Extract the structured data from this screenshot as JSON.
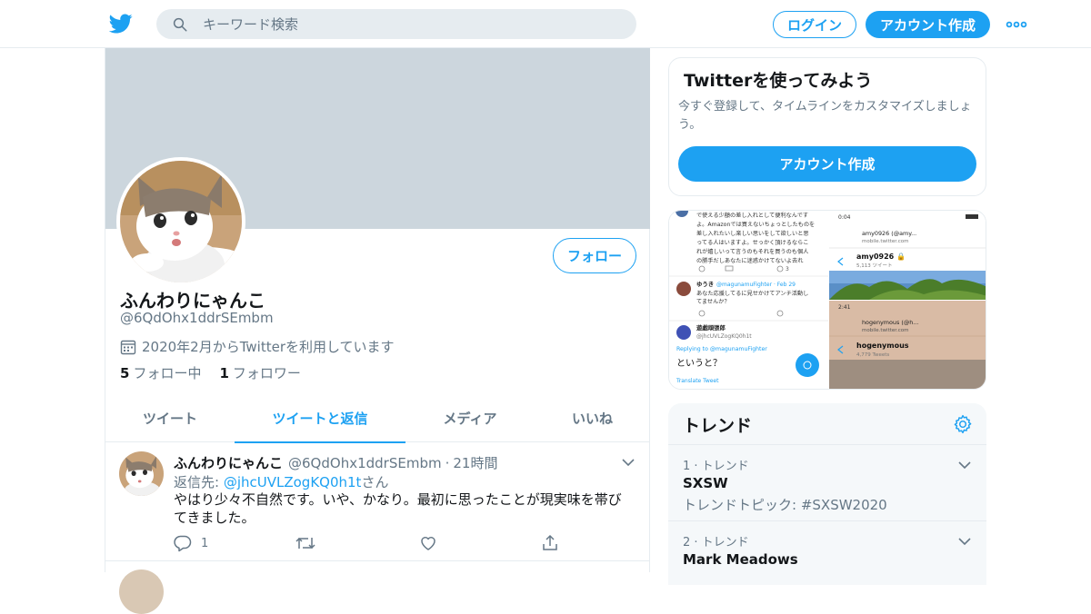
{
  "colors": {
    "accent": "#1da1f2",
    "muted": "#657786",
    "text": "#14171a",
    "banner": "#ccd6dd"
  },
  "header": {
    "search_placeholder": "キーワード検索",
    "login_label": "ログイン",
    "signup_label": "アカウント作成"
  },
  "profile": {
    "display_name": "ふんわりにゃんこ",
    "handle": "@6QdOhx1ddrSEmbm",
    "joined": "2020年2月からTwitterを利用しています",
    "following_count": "5",
    "following_label": "フォロー中",
    "followers_count": "1",
    "followers_label": "フォロワー",
    "follow_button": "フォロー"
  },
  "tabs": [
    {
      "label": "ツイート",
      "active": false
    },
    {
      "label": "ツイートと返信",
      "active": true
    },
    {
      "label": "メディア",
      "active": false
    },
    {
      "label": "いいね",
      "active": false
    }
  ],
  "tweet": {
    "name": "ふんわりにゃんこ",
    "handle": "@6QdOhx1ddrSEmbm",
    "dot": "·",
    "time": "21時間",
    "reply_prefix": "返信先: ",
    "reply_mention": "@jhcUVLZogKQ0h1t",
    "reply_suffix": "さん",
    "text": "やはり少々不自然です。いや、かなり。最初に思ったことが現実味を帯びてきました。",
    "reply_count": "1"
  },
  "signup_card": {
    "title": "Twitterを使ってみよう",
    "description": "今すぐ登録して、タイムラインをカスタマイズしましょう。",
    "button": "アカウント作成"
  },
  "media": {
    "left_panel": {
      "lines": [
        "で使える少額の差し入れとして便利なんです",
        "よ。Amazonでは買えないちょっとしたものを",
        "差し入れたいし楽しい思いをして欲しいと思",
        "ってる人はいますよ。せっかく頂けるならこ",
        "れが嬉しいって言うのもそれを買うのも個人",
        "の勝手だしあなたに迷惑かけてないよ去れ"
      ],
      "reply_user": "ゆうき",
      "reply_handle": "@magunamuFighter · Feb 29",
      "reply_text_1": "あなた応援してるに見せかけてアンチ活動し",
      "reply_text_2": "てませんか？",
      "user2": "遊戯頑張郎",
      "user2_handle": "@jhcUVLZogKQ0h1t",
      "replying": "Replying to @magunamuFighter",
      "big_text": "というと？",
      "translate": "Translate Tweet",
      "like_count": "3"
    },
    "right_top": {
      "time": "0:04",
      "url_title": "amy0926 (@amy...",
      "url": "mobile.twitter.com",
      "profile_name": "amy0926 🔒",
      "profile_sub": "5,113 ツイート"
    },
    "right_bottom": {
      "time": "2:41",
      "url_title": "hogenymous (@h...",
      "url": "mobile.twitter.com",
      "profile_name": "hogenymous",
      "profile_sub": "4,779 Tweets"
    }
  },
  "trends": {
    "title": "トレンド",
    "items": [
      {
        "meta": "1 · トレンド",
        "name": "SXSW",
        "sub": "トレンドトピック: #SXSW2020"
      },
      {
        "meta": "2 · トレンド",
        "name": "Mark Meadows",
        "sub": ""
      }
    ]
  }
}
